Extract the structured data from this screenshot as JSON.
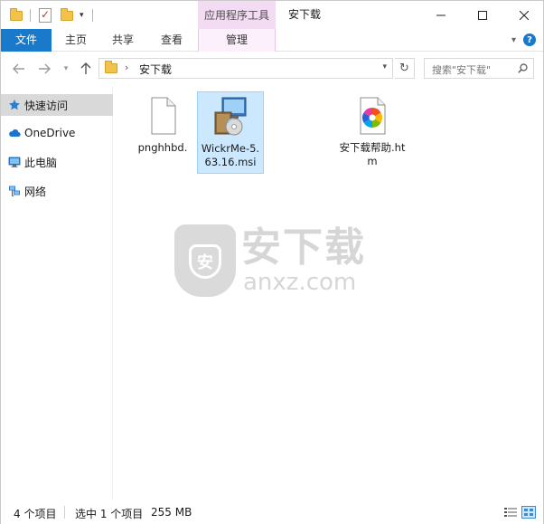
{
  "window": {
    "title": "安下载",
    "context_tab_group": "应用程序工具"
  },
  "ribbon": {
    "tabs": [
      "文件",
      "主页",
      "共享",
      "查看",
      "管理"
    ]
  },
  "address": {
    "path": "安下载",
    "search_placeholder": "搜索\"安下载\""
  },
  "sidebar": {
    "items": [
      {
        "label": "快速访问",
        "icon": "star-icon",
        "active": true
      },
      {
        "label": "OneDrive",
        "icon": "cloud-icon",
        "active": false
      },
      {
        "label": "此电脑",
        "icon": "computer-icon",
        "active": false
      },
      {
        "label": "网络",
        "icon": "network-icon",
        "active": false
      }
    ]
  },
  "files": [
    {
      "name": "pnghhbd.",
      "icon": "blank-file-icon",
      "selected": false
    },
    {
      "name": "WickrMe-5.63.16.msi",
      "icon": "installer-icon",
      "selected": true
    },
    {
      "name": "安下载帮助.htm",
      "icon": "htm-file-icon",
      "selected": false
    }
  ],
  "watermark": {
    "cn": "安下载",
    "en": "anxz.com",
    "shield_char": "安"
  },
  "status": {
    "count": "4 个项目",
    "selection": "选中 1 个项目",
    "size": "255 MB"
  },
  "colors": {
    "accent": "#1979ca",
    "selection_bg": "#cce8ff",
    "context_tab": "#f4dbf4"
  }
}
